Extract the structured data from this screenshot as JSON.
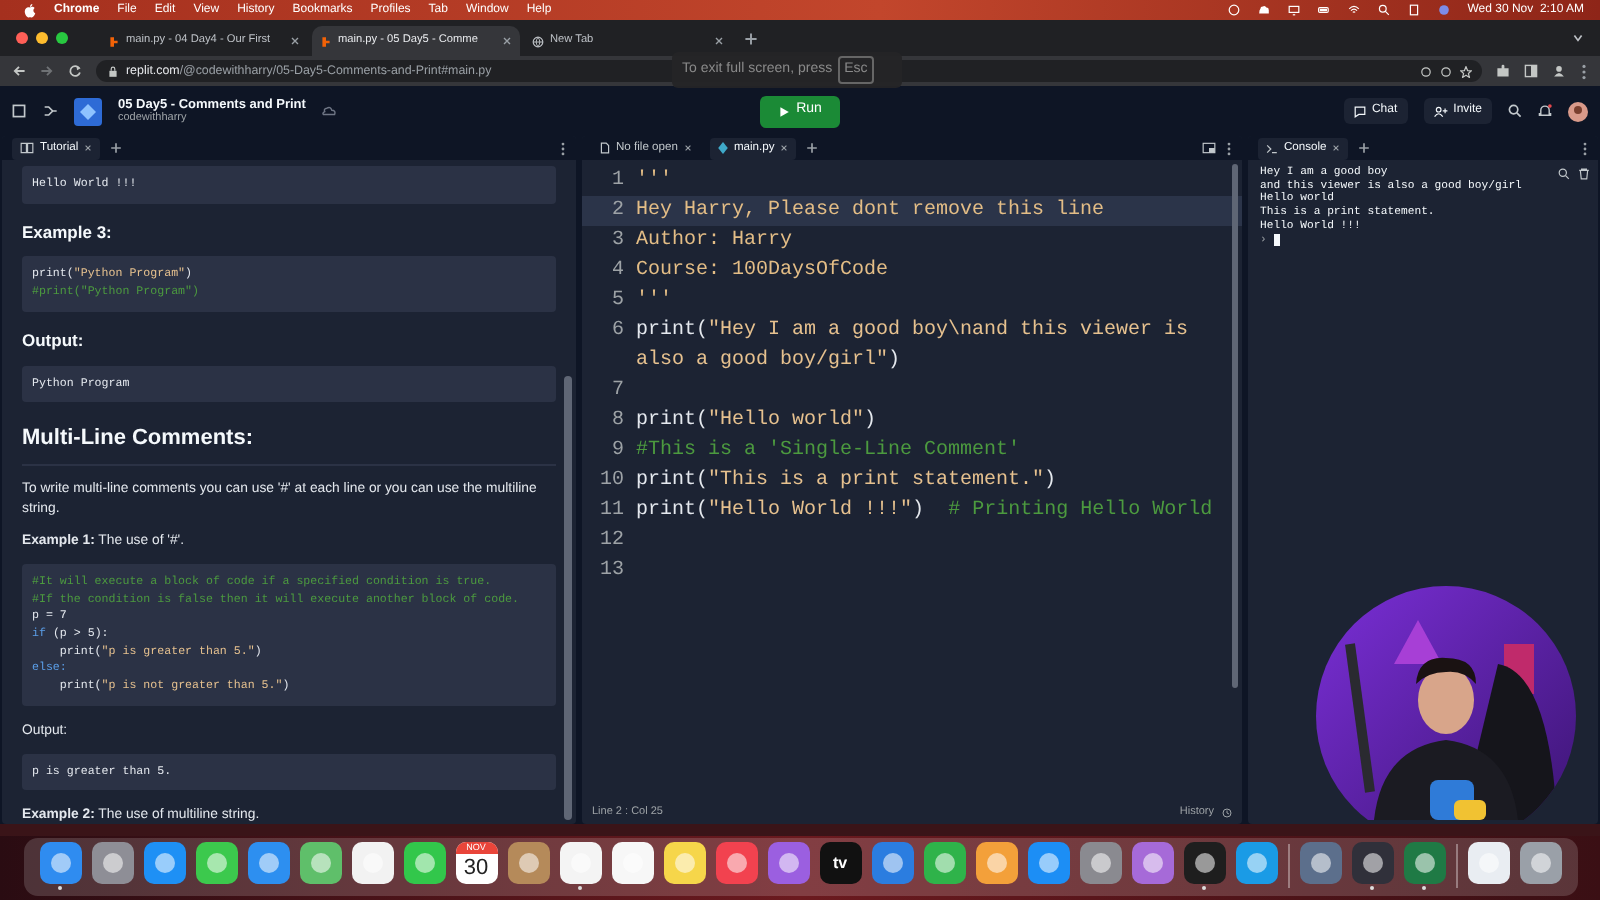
{
  "menu_bar": {
    "items": [
      "Chrome",
      "File",
      "Edit",
      "View",
      "History",
      "Bookmarks",
      "Profiles",
      "Tab",
      "Window",
      "Help"
    ],
    "clock": "Wed 30 Nov  2:10 AM"
  },
  "browser": {
    "tabs": [
      {
        "title": "main.py - 04 Day4 - Our First",
        "selected": false
      },
      {
        "title": "main.py - 05 Day5 - Comme",
        "selected": true
      },
      {
        "title": "New Tab",
        "selected": false
      }
    ],
    "url_host": "replit.com",
    "url_path": "/@codewithharry/05-Day5-Comments-and-Print#main.py",
    "fullscreen_hint": {
      "text": "To exit full screen, press",
      "key": "Esc"
    }
  },
  "repl": {
    "title": "05 Day5 - Comments and Print",
    "owner": "codewithharry",
    "run": "Run",
    "chat": "Chat",
    "invite": "Invite"
  },
  "tutorial": {
    "tab": "Tutorial",
    "blocks": [
      {
        "kind": "code",
        "lines": [
          [
            {
              "text": "Hello World !!!",
              "kind": "plain"
            }
          ]
        ]
      },
      {
        "kind": "heading",
        "text": "Example 3:"
      },
      {
        "kind": "code",
        "lines": [
          [
            {
              "text": "print(",
              "kind": "plain"
            },
            {
              "text": "\"Python Program\"",
              "kind": "str"
            },
            {
              "text": ")",
              "kind": "plain"
            }
          ],
          [
            {
              "text": "#print(\"Python Program\")",
              "kind": "cmt"
            }
          ]
        ]
      },
      {
        "kind": "heading",
        "text": "Output:"
      },
      {
        "kind": "code",
        "lines": [
          [
            {
              "text": "Python Program",
              "kind": "plain"
            }
          ]
        ]
      },
      {
        "kind": "title",
        "text": "Multi-Line Comments:"
      },
      {
        "kind": "para",
        "text": "To write multi-line comments you can use '#' at each line or you can use the multiline string."
      },
      {
        "kind": "para",
        "text": "**Example 1:** The use of '#'."
      },
      {
        "kind": "code",
        "lines": [
          [
            {
              "text": "#It will execute a block of code if a specified condition is true.",
              "kind": "cmt"
            }
          ],
          [
            {
              "text": "#If the condition is false then it will execute another block of code.",
              "kind": "cmt"
            }
          ],
          [
            {
              "text": "p = 7",
              "kind": "plain"
            }
          ],
          [
            {
              "text": "if",
              "kind": "kw"
            },
            {
              "text": " (p > 5):",
              "kind": "plain"
            }
          ],
          [
            {
              "text": "    print(",
              "kind": "plain"
            },
            {
              "text": "\"p is greater than 5.\"",
              "kind": "str"
            },
            {
              "text": ")",
              "kind": "plain"
            }
          ],
          [
            {
              "text": "else:",
              "kind": "kw"
            }
          ],
          [
            {
              "text": "    print(",
              "kind": "plain"
            },
            {
              "text": "\"p is not greater than 5.\"",
              "kind": "str"
            },
            {
              "text": ")",
              "kind": "plain"
            }
          ]
        ]
      },
      {
        "kind": "para",
        "text": "Output:"
      },
      {
        "kind": "code",
        "lines": [
          [
            {
              "text": "p is greater than 5.",
              "kind": "plain"
            }
          ]
        ]
      },
      {
        "kind": "para",
        "text": "**Example 2:** The use of multiline string."
      }
    ]
  },
  "editor": {
    "tabs": [
      {
        "label": "No file open",
        "selected": false
      },
      {
        "label": "main.py",
        "selected": true
      }
    ],
    "lines": [
      {
        "number": "1",
        "current": false,
        "parts": [
          {
            "text": "'''",
            "kind": "doc"
          }
        ]
      },
      {
        "number": "2",
        "current": true,
        "parts": [
          {
            "text": "Hey Harry, Please dont remove this line",
            "kind": "doc"
          }
        ]
      },
      {
        "number": "3",
        "current": false,
        "parts": [
          {
            "text": "Author: Harry",
            "kind": "doc"
          }
        ]
      },
      {
        "number": "4",
        "current": false,
        "parts": [
          {
            "text": "Course: 100DaysOfCode",
            "kind": "doc"
          }
        ]
      },
      {
        "number": "5",
        "current": false,
        "parts": [
          {
            "text": "'''",
            "kind": "doc"
          }
        ]
      },
      {
        "number": "6",
        "current": false,
        "parts": [
          {
            "text": "print(",
            "kind": "plain"
          },
          {
            "text": "\"Hey I am a good boy\\nand this viewer is also a good boy/girl\"",
            "kind": "str"
          },
          {
            "text": ")",
            "kind": "plain"
          }
        ]
      },
      {
        "number": "7",
        "current": false
      },
      {
        "number": "8",
        "current": false,
        "parts": [
          {
            "text": "print(",
            "kind": "plain"
          },
          {
            "text": "\"Hello world\"",
            "kind": "str"
          },
          {
            "text": ")",
            "kind": "plain"
          }
        ]
      },
      {
        "number": "9",
        "current": false,
        "parts": [
          {
            "text": "#This is a 'Single-Line Comment'",
            "kind": "cmt"
          }
        ]
      },
      {
        "number": "10",
        "current": false,
        "parts": [
          {
            "text": "print(",
            "kind": "plain"
          },
          {
            "text": "\"This is a print statement.\"",
            "kind": "str"
          },
          {
            "text": ")",
            "kind": "plain"
          }
        ]
      },
      {
        "number": "11",
        "current": false,
        "parts": [
          {
            "text": "print(",
            "kind": "plain"
          },
          {
            "text": "\"Hello World !!!\"",
            "kind": "str"
          },
          {
            "text": ")  ",
            "kind": "plain"
          },
          {
            "text": "# Printing Hello World",
            "kind": "cmt"
          }
        ]
      },
      {
        "number": "12",
        "current": false
      },
      {
        "number": "13",
        "current": false
      }
    ],
    "status": "Line 2 : Col 25",
    "history": "History"
  },
  "console": {
    "tab": "Console",
    "lines": [
      "Hey I am a good boy",
      "and this viewer is also a good boy/girl",
      "Hello world",
      "This is a print statement.",
      "Hello World !!!"
    ],
    "prompt": "›"
  },
  "dock": [
    {
      "kind": "app",
      "color": "#2f8cf0",
      "running": true
    },
    {
      "kind": "app",
      "color": "#8e8e96",
      "running": false
    },
    {
      "kind": "app",
      "color": "#1e90f5",
      "running": false
    },
    {
      "kind": "app",
      "color": "#3cc94d",
      "running": false
    },
    {
      "kind": "app",
      "color": "#2d8ff0",
      "running": false
    },
    {
      "kind": "app",
      "color": "#5fbf6a",
      "running": false
    },
    {
      "kind": "app",
      "color": "#f2f2f2",
      "running": false
    },
    {
      "kind": "app",
      "color": "#32c74b",
      "running": false
    },
    {
      "kind": "calendar",
      "month": "NOV",
      "day": "30",
      "running": false
    },
    {
      "kind": "app",
      "color": "#b58a5a",
      "running": false
    },
    {
      "kind": "app",
      "color": "#f4f4f4",
      "running": true
    },
    {
      "kind": "app",
      "color": "#f7f7f7",
      "running": false
    },
    {
      "kind": "app",
      "color": "#f6d64a",
      "running": false
    },
    {
      "kind": "app",
      "color": "#f2424f",
      "running": false
    },
    {
      "kind": "app",
      "color": "#9b5fe0",
      "running": false
    },
    {
      "kind": "tv",
      "label": "tv",
      "running": false
    },
    {
      "kind": "app",
      "color": "#2b7de0",
      "running": false
    },
    {
      "kind": "app",
      "color": "#2fb34a",
      "running": false
    },
    {
      "kind": "app",
      "color": "#f3a03a",
      "running": false
    },
    {
      "kind": "app",
      "color": "#1c8ef5",
      "running": false
    },
    {
      "kind": "app",
      "color": "#8a8a90",
      "running": false
    },
    {
      "kind": "app",
      "color": "#a66ad8",
      "running": false
    },
    {
      "kind": "app",
      "color": "#1e1e1e",
      "running": true
    },
    {
      "kind": "app",
      "color": "#1a9be6",
      "running": false
    },
    {
      "kind": "divider"
    },
    {
      "kind": "app",
      "color": "#5c6f8c",
      "running": false
    },
    {
      "kind": "app",
      "color": "#30303a",
      "running": true
    },
    {
      "kind": "app",
      "color": "#1f7a45",
      "running": true
    },
    {
      "kind": "divider"
    },
    {
      "kind": "app",
      "color": "#e9edf2",
      "running": false
    },
    {
      "kind": "app",
      "color": "#9aa0a8",
      "running": false
    }
  ]
}
